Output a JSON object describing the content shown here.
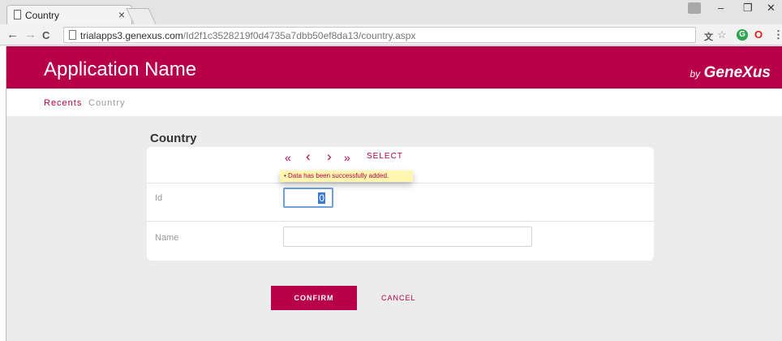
{
  "browser": {
    "tab_title": "Country",
    "tab_close": "×",
    "url_host": "trialapps3.genexus.com",
    "url_path": "/Id2f1c3528219f0d4735a7dbb50ef8da13/country.aspx",
    "nav_back": "←",
    "nav_forward": "→",
    "nav_reload": "C",
    "win_minimize": "–",
    "win_restore": "❐",
    "win_close": "✕",
    "ext_star": "☆",
    "ext_g": "G",
    "ext_o": "O",
    "ext_menu": "⋮",
    "ext_translate": "文"
  },
  "app": {
    "name": "Application Name",
    "by": "by",
    "brand": "GeneXus"
  },
  "breadcrumb": {
    "recents": "Recents",
    "current": "Country"
  },
  "form": {
    "title": "Country",
    "nav_first": "«",
    "nav_prev": "‹",
    "nav_next": "›",
    "nav_last": "»",
    "select": "SELECT",
    "message": "Data has been successfully added.",
    "id_label": "Id",
    "id_value": "0",
    "name_label": "Name",
    "name_value": ""
  },
  "actions": {
    "confirm": "CONFIRM",
    "cancel": "CANCEL"
  },
  "colors": {
    "brand": "#b8004a",
    "background": "#ececec",
    "message_bg": "#fff7b0"
  }
}
